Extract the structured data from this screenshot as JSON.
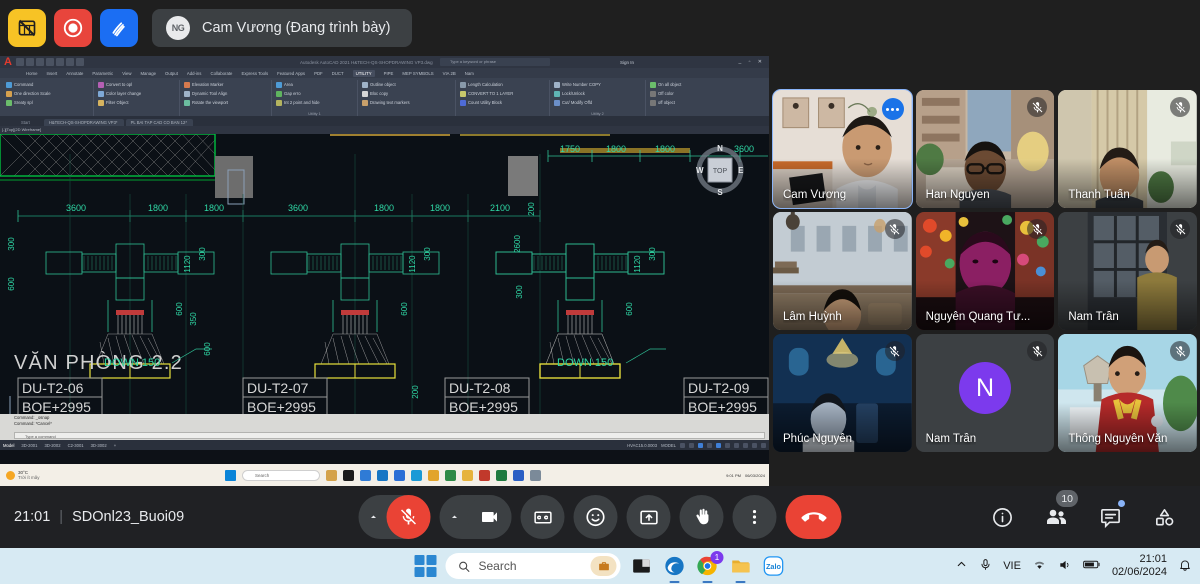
{
  "topbar": {
    "icons": [
      {
        "name": "spreadsheet-blocked-icon",
        "color": "#f7c325"
      },
      {
        "name": "record-icon",
        "color": "#e8453c"
      },
      {
        "name": "whiteboard-icon",
        "color": "#1b6ef3"
      }
    ],
    "presenting": {
      "avatar_initials": "NG",
      "title": "Cam Vương (Đang trình bày)"
    }
  },
  "shared_screen": {
    "app": "Autodesk AutoCAD 2021",
    "title_text": "Autodesk AutoCAD 2021    H&TECH-QS-SHOPDRAWING VP3.dwg",
    "search_placeholder": "Type a keyword or phrase",
    "signin_label": "Sign In",
    "ribbon_tabs": [
      "Home",
      "Insert",
      "Annotate",
      "Parametric",
      "View",
      "Manage",
      "Output",
      "Add-ins",
      "Collaborate",
      "Express Tools",
      "Featured Apps",
      "PDF",
      "DUCT",
      "UTILITY",
      "PIPE",
      "MEP SYMBOLS",
      "VIA 2B",
      "Nam"
    ],
    "ribbon_selected_tab": "UTILITY",
    "panels": [
      {
        "label": "Utility 1",
        "rows": [
          [
            "Command",
            "Convert to opl",
            "Elevation Marker",
            "Area",
            "Outline object",
            "Length Calculation",
            "Make/ Unbale Object"
          ],
          [
            "One direction Scale",
            "Color layer change",
            "Dynamic Tool Align",
            "Gap erro",
            "Bloc copy",
            "CONVERT TO 1 LAYER",
            "Creat Dim Style"
          ],
          [
            "Sreaty spl",
            "Filter Object",
            "Rotate the viewport",
            "Int 2 point and hide",
            "Drawing text markers",
            "Count Utility Block",
            "Draw Paper size"
          ]
        ]
      },
      {
        "label": "Utility 2",
        "rows": [
          [
            "Write Number COPY",
            "On all object"
          ],
          [
            "Lock/Unlock",
            "Off color"
          ],
          [
            "Cut/ Modify Offd",
            "off object"
          ]
        ]
      }
    ],
    "doc_tabs": [
      "Start",
      "H&TECH-QS-SHOPDRAWING VP3*",
      "PL BAI TAP CAD CO BAN 12*"
    ],
    "layerbar": "[-][Top][2D Wireframe]",
    "command_history": [
      "Command:  _osnap",
      "Command:  *Cancel*"
    ],
    "command_placeholder": "Type a command",
    "status_tabs": [
      "Model",
      "3D-2001",
      "3D-2002",
      "C2-3001",
      "3D-3002",
      "+"
    ],
    "status_right": [
      "HVAC15.0.0003",
      "MODEL"
    ],
    "viewcube": {
      "top": "TOP",
      "n": "N",
      "s": "S",
      "e": "E",
      "w": "W"
    },
    "drawing": {
      "room_label": "VĂN PHÒNG 2.2",
      "down_labels": [
        "DOWN 150",
        "DOWN 150"
      ],
      "tag_boxes": [
        {
          "code": "DU-T2-06",
          "level": "BOE+2995"
        },
        {
          "code": "DU-T2-07",
          "level": "BOE+2995"
        },
        {
          "code": "DU-T2-08",
          "level": "BOE+2995"
        },
        {
          "code": "DU-T2-09",
          "level": "BOE+2995"
        }
      ],
      "dims_bottom": [
        "3600",
        "1800",
        "1800",
        "3600",
        "1800",
        "1800",
        "2100"
      ],
      "dims_top": [
        "1750",
        "1800",
        "1800",
        "3600"
      ],
      "dims_vertical": [
        "1120",
        "300",
        "600",
        "350",
        "600",
        "200",
        "300"
      ]
    },
    "taskbar": {
      "weather_temp": "30°C",
      "weather_desc": "Trời ít mây",
      "search_placeholder": "Search",
      "clock": "9:01 PM",
      "date": "06/03/2024"
    }
  },
  "participants": [
    {
      "name": "Cam Vương",
      "muted": false,
      "active": true,
      "presenting": true,
      "avatar": null
    },
    {
      "name": "Han Nguyen",
      "muted": true,
      "active": false,
      "presenting": false,
      "avatar": null
    },
    {
      "name": "Thanh Tuấn",
      "muted": true,
      "active": false,
      "presenting": false,
      "avatar": null
    },
    {
      "name": "Lâm Huỳnh",
      "muted": true,
      "active": false,
      "presenting": false,
      "avatar": null
    },
    {
      "name": "Nguyễn Quang Tư...",
      "muted": true,
      "active": false,
      "presenting": false,
      "avatar": null
    },
    {
      "name": "Nam Trần",
      "muted": true,
      "active": false,
      "presenting": false,
      "avatar": null
    },
    {
      "name": "Phúc Nguyên",
      "muted": true,
      "active": false,
      "presenting": false,
      "avatar": null
    },
    {
      "name": "Nam Trần",
      "muted": true,
      "active": false,
      "presenting": false,
      "avatar": "N"
    },
    {
      "name": "Thống Nguyễn Văn",
      "muted": true,
      "active": false,
      "presenting": false,
      "avatar": null
    }
  ],
  "bottombar": {
    "time": "21:01",
    "separator": "|",
    "meeting_code": "SDOnl23_Buoi09",
    "controls": [
      {
        "name": "microphone-muted-button",
        "state": "muted"
      },
      {
        "name": "camera-button",
        "state": "off"
      },
      {
        "name": "captions-button",
        "label": "CC"
      },
      {
        "name": "emoji-button"
      },
      {
        "name": "present-screen-button"
      },
      {
        "name": "raise-hand-button"
      },
      {
        "name": "more-options-button"
      },
      {
        "name": "end-call-button"
      }
    ],
    "right_controls": [
      {
        "name": "meeting-details-button",
        "badge": null
      },
      {
        "name": "people-button",
        "badge": "10"
      },
      {
        "name": "chat-button",
        "badge": null,
        "dot": true
      },
      {
        "name": "activities-button",
        "badge": null
      }
    ]
  },
  "windows_taskbar": {
    "search_placeholder": "Search",
    "apps": [
      "briefcase-icon",
      "windows-terminal-icon",
      "edge-icon",
      "chrome-icon",
      "file-explorer-icon",
      "zalo-icon"
    ],
    "chrome_badge": "1",
    "zalo_label": "Zalo",
    "tray": {
      "language": "VIE",
      "chevron": "show-hidden-icons",
      "mic": "microphone-icon",
      "wifi": "wifi-icon",
      "volume": "speaker-icon",
      "battery": "battery-icon",
      "time": "21:01",
      "date": "02/06/2024",
      "bell": "notification-bell-icon"
    }
  }
}
